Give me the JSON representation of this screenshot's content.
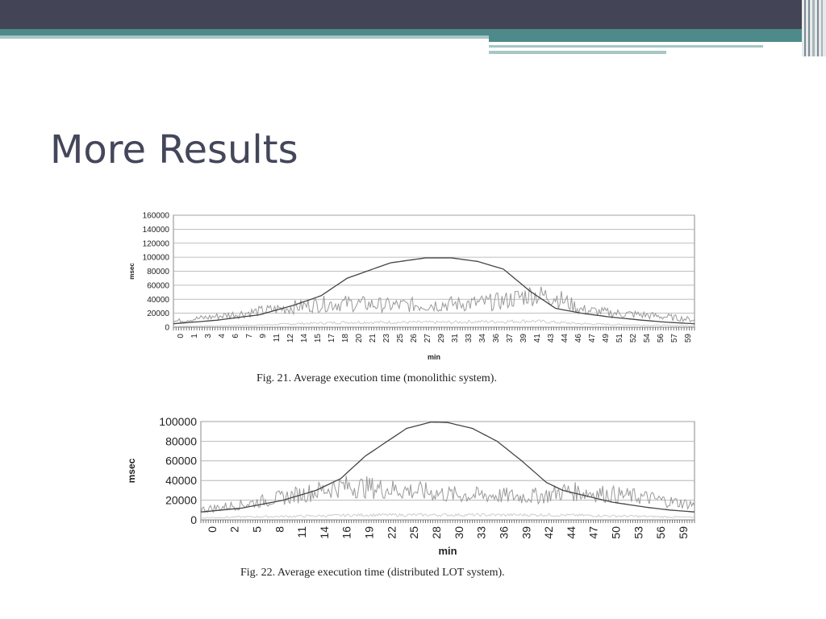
{
  "slide": {
    "title": "More Results"
  },
  "figures": [
    {
      "caption": "Fig. 21.   Average execution time (monolithic system).",
      "chart_data": {
        "type": "line",
        "ylabel": "msec",
        "xlabel": "min",
        "ylim": [
          0,
          160000
        ],
        "yticks": [
          "0",
          "20000",
          "40000",
          "60000",
          "80000",
          "100000",
          "120000",
          "140000",
          "160000"
        ],
        "xticks": [
          "0",
          "1",
          "3",
          "4",
          "6",
          "7",
          "9",
          "11",
          "12",
          "14",
          "15",
          "17",
          "18",
          "20",
          "21",
          "23",
          "25",
          "26",
          "27",
          "29",
          "31",
          "33",
          "34",
          "36",
          "37",
          "39",
          "41",
          "43",
          "44",
          "46",
          "47",
          "49",
          "51",
          "52",
          "54",
          "56",
          "57",
          "59"
        ],
        "xlim": [
          0,
          60
        ],
        "grid": true,
        "series": [
          {
            "x": [
              0,
              5,
              10,
              14,
              17,
              20,
              25,
              29,
              32,
              35,
              38,
              41,
              44,
              47,
              50,
              54,
              57,
              60
            ],
            "values": [
              5000,
              10000,
              18000,
              32000,
              45000,
              70000,
              92000,
              99000,
              99000,
              94000,
              83000,
              52000,
              27000,
              20000,
              15000,
              10000,
              7000,
              5000
            ]
          },
          {
            "x": [
              0,
              5,
              10,
              14,
              17,
              20,
              25,
              29,
              32,
              35,
              38,
              41,
              44,
              47,
              50,
              54,
              57,
              60
            ],
            "values": [
              8000,
              15000,
              22000,
              28000,
              32000,
              33000,
              30000,
              31000,
              32000,
              33000,
              36000,
              45000,
              42000,
              24000,
              20000,
              17000,
              14000,
              10000
            ]
          },
          {
            "x": [
              0,
              5,
              10,
              14,
              17,
              20,
              25,
              29,
              32,
              35,
              38,
              41,
              44,
              47,
              50,
              54,
              57,
              60
            ],
            "values": [
              1000,
              2000,
              3000,
              5000,
              6000,
              7000,
              7000,
              7000,
              7000,
              8000,
              8000,
              9000,
              7000,
              5000,
              4000,
              3000,
              2500,
              2000
            ]
          }
        ]
      }
    },
    {
      "caption": "Fig. 22.   Average execution time (distributed LOT system).",
      "chart_data": {
        "type": "line",
        "ylabel": "msec",
        "xlabel": "min",
        "ylim": [
          0,
          100000
        ],
        "yticks": [
          "0",
          "20000",
          "40000",
          "60000",
          "80000",
          "100000"
        ],
        "xticks": [
          "0",
          "2",
          "5",
          "8",
          "11",
          "14",
          "16",
          "19",
          "22",
          "25",
          "28",
          "30",
          "33",
          "36",
          "39",
          "42",
          "44",
          "47",
          "50",
          "53",
          "56",
          "59"
        ],
        "xlim": [
          0,
          60
        ],
        "grid": true,
        "series": [
          {
            "x": [
              0,
              5,
              10,
              14,
              17,
              20,
              25,
              28,
              30,
              33,
              36,
              39,
              42,
              44,
              47,
              50,
              54,
              57,
              60
            ],
            "values": [
              8000,
              12000,
              20000,
              30000,
              42000,
              65000,
              93000,
              99500,
              99000,
              93000,
              80000,
              60000,
              38000,
              30000,
              24000,
              18000,
              13000,
              10000,
              8000
            ]
          },
          {
            "x": [
              0,
              5,
              10,
              14,
              17,
              20,
              25,
              28,
              30,
              33,
              36,
              39,
              42,
              44,
              47,
              50,
              54,
              57,
              60
            ],
            "values": [
              10000,
              15000,
              22000,
              28000,
              33000,
              32000,
              29000,
              27000,
              25000,
              24000,
              24000,
              23000,
              24000,
              28000,
              27000,
              25000,
              22000,
              18000,
              15000
            ]
          },
          {
            "x": [
              0,
              5,
              10,
              14,
              17,
              20,
              25,
              28,
              30,
              33,
              36,
              39,
              42,
              44,
              47,
              50,
              54,
              57,
              60
            ],
            "values": [
              2000,
              3000,
              3500,
              4000,
              4500,
              5000,
              5000,
              5000,
              5000,
              5000,
              5000,
              5000,
              5000,
              4800,
              4500,
              4000,
              3500,
              3000,
              2500
            ]
          }
        ]
      }
    }
  ],
  "colors": {
    "header_bar": "#434456",
    "teal": "#4f8a8b",
    "teal_light": "#a7c6c6",
    "title": "#44465a",
    "curve_theoretical": "#444444",
    "curve_measured": "#999999",
    "curve_low": "#cccccc"
  }
}
